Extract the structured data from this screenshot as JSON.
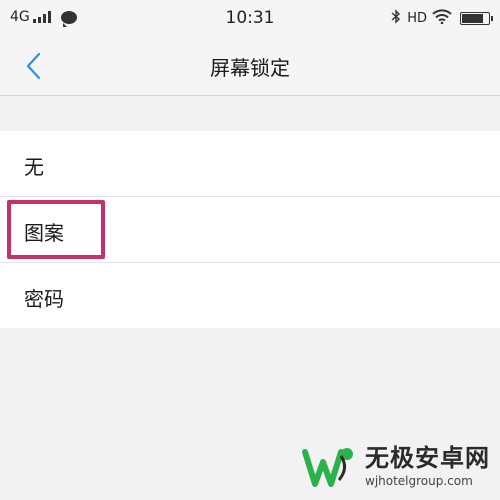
{
  "status_bar": {
    "network": "4G",
    "time": "10:31",
    "hd": "HD",
    "battery_level": 0.85,
    "icons": [
      "signal-icon",
      "chat-icon",
      "bluetooth-icon",
      "wifi-icon",
      "battery-icon"
    ]
  },
  "header": {
    "title": "屏幕锁定",
    "back_icon": "chevron-left-icon"
  },
  "options": [
    {
      "label": "无"
    },
    {
      "label": "图案"
    },
    {
      "label": "密码"
    }
  ],
  "highlight": {
    "target": "图案",
    "color": "#c8306a"
  },
  "watermark": {
    "title": "无极安卓网",
    "url": "wjhotelgroup.com"
  },
  "colors": {
    "accent": "#2f8fe6",
    "background": "#f2f2f2",
    "list_background": "#ffffff",
    "highlight": "#c8306a",
    "logo_green": "#2bb24c"
  }
}
